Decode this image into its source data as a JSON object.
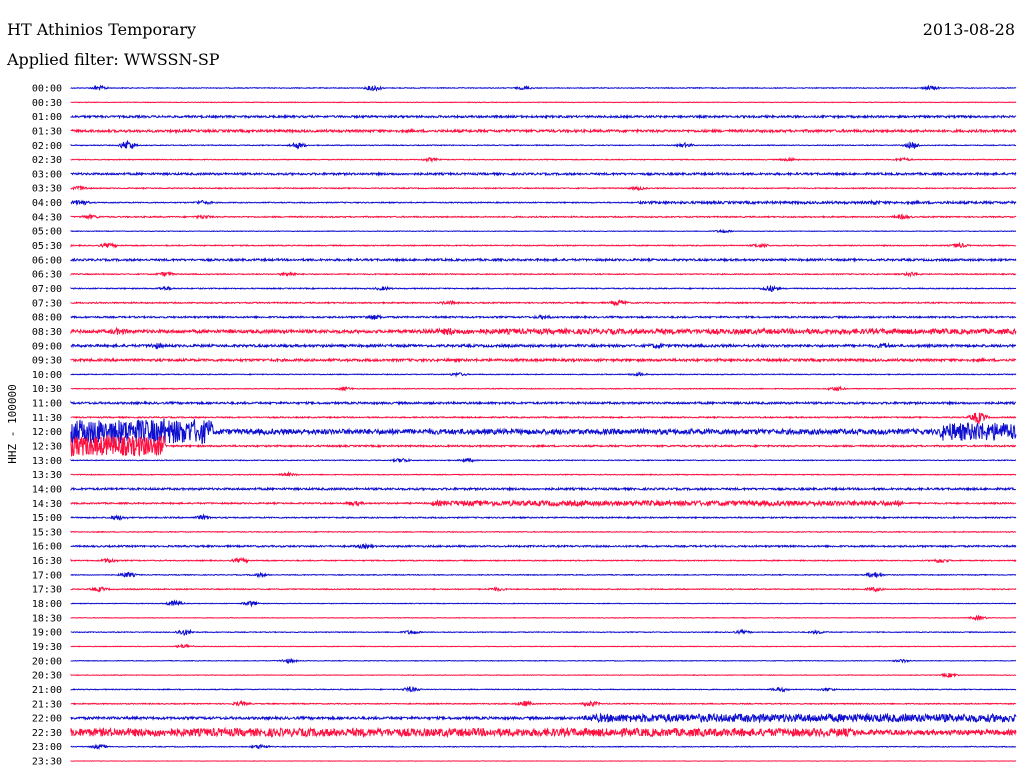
{
  "header": {
    "title": "HT Athinios Temporary",
    "date": "2013-08-28",
    "filter": "Applied filter: WWSSN-SP"
  },
  "chart_data": {
    "type": "line",
    "title": "HT Athinios Temporary",
    "ylabel": "HHZ - 100000",
    "colors": [
      "#1010d0",
      "#ff1040"
    ],
    "rows": [
      {
        "label": "00:00",
        "amp": 0.4,
        "events": [
          [
            0.03,
            2
          ],
          [
            0.32,
            3
          ],
          [
            0.48,
            1.5
          ],
          [
            0.91,
            2
          ]
        ]
      },
      {
        "label": "00:30",
        "amp": 0.3,
        "events": []
      },
      {
        "label": "01:00",
        "amp": 1.0,
        "events": []
      },
      {
        "label": "01:30",
        "amp": 1.2,
        "events": []
      },
      {
        "label": "02:00",
        "amp": 0.4,
        "events": [
          [
            0.06,
            5
          ],
          [
            0.24,
            3
          ],
          [
            0.65,
            2
          ],
          [
            0.89,
            3
          ]
        ]
      },
      {
        "label": "02:30",
        "amp": 0.4,
        "events": [
          [
            0.38,
            1.5
          ],
          [
            0.76,
            1.5
          ],
          [
            0.88,
            1.5
          ]
        ]
      },
      {
        "label": "03:00",
        "amp": 1.0,
        "events": []
      },
      {
        "label": "03:30",
        "amp": 0.5,
        "events": [
          [
            0.01,
            2
          ],
          [
            0.6,
            1.5
          ]
        ]
      },
      {
        "label": "04:00",
        "amp": 0.5,
        "events": [
          [
            0.01,
            3
          ],
          [
            0.14,
            2
          ],
          [
            0.85,
            2
          ]
        ]
      },
      {
        "label": "04:30",
        "amp": 0.6,
        "events": [
          [
            0.02,
            2
          ],
          [
            0.14,
            1.5
          ],
          [
            0.88,
            2
          ]
        ]
      },
      {
        "label": "05:00",
        "amp": 0.3,
        "events": [
          [
            0.69,
            1.5
          ]
        ]
      },
      {
        "label": "05:30",
        "amp": 0.5,
        "events": [
          [
            0.04,
            2
          ],
          [
            0.73,
            2
          ],
          [
            0.94,
            2
          ]
        ]
      },
      {
        "label": "06:00",
        "amp": 1.0,
        "events": []
      },
      {
        "label": "06:30",
        "amp": 0.5,
        "events": [
          [
            0.1,
            2
          ],
          [
            0.23,
            2
          ],
          [
            0.89,
            2
          ]
        ]
      },
      {
        "label": "07:00",
        "amp": 0.5,
        "events": [
          [
            0.74,
            3
          ],
          [
            0.1,
            1.5
          ],
          [
            0.33,
            1.5
          ]
        ]
      },
      {
        "label": "07:30",
        "amp": 0.6,
        "events": [
          [
            0.58,
            2.5
          ],
          [
            0.4,
            1.5
          ]
        ]
      },
      {
        "label": "08:00",
        "amp": 0.8,
        "events": [
          [
            0.32,
            2
          ],
          [
            0.5,
            1.5
          ]
        ]
      },
      {
        "label": "08:30",
        "amp": 1.6,
        "events": [
          [
            0.4,
            2.5
          ],
          [
            0.05,
            2
          ]
        ]
      },
      {
        "label": "09:00",
        "amp": 1.0,
        "events": [
          [
            0.09,
            2
          ],
          [
            0.62,
            2
          ],
          [
            0.86,
            2
          ]
        ]
      },
      {
        "label": "09:30",
        "amp": 1.2,
        "events": []
      },
      {
        "label": "10:00",
        "amp": 0.4,
        "events": [
          [
            0.41,
            1.5
          ],
          [
            0.6,
            1.5
          ]
        ]
      },
      {
        "label": "10:30",
        "amp": 0.4,
        "events": [
          [
            0.29,
            1.5
          ],
          [
            0.81,
            2
          ]
        ]
      },
      {
        "label": "11:00",
        "amp": 1.0,
        "events": []
      },
      {
        "label": "11:30",
        "amp": 0.6,
        "events": [
          [
            0.96,
            6
          ]
        ]
      },
      {
        "label": "12:00",
        "amp": 1.8,
        "events": [
          [
            0.1,
            14
          ],
          [
            0.96,
            10
          ]
        ]
      },
      {
        "label": "12:30",
        "amp": 0.8,
        "events": [
          [
            0.04,
            12
          ]
        ]
      },
      {
        "label": "13:00",
        "amp": 0.4,
        "events": [
          [
            0.35,
            2
          ],
          [
            0.42,
            1.5
          ]
        ]
      },
      {
        "label": "13:30",
        "amp": 0.4,
        "events": [
          [
            0.23,
            1.5
          ]
        ]
      },
      {
        "label": "14:00",
        "amp": 1.0,
        "events": []
      },
      {
        "label": "14:30",
        "amp": 0.7,
        "events": [
          [
            0.54,
            2.5
          ],
          [
            0.3,
            2
          ]
        ]
      },
      {
        "label": "15:00",
        "amp": 0.6,
        "events": [
          [
            0.05,
            2
          ],
          [
            0.14,
            2
          ]
        ]
      },
      {
        "label": "15:30",
        "amp": 0.4,
        "events": []
      },
      {
        "label": "16:00",
        "amp": 0.8,
        "events": [
          [
            0.31,
            1.5
          ]
        ]
      },
      {
        "label": "16:30",
        "amp": 0.5,
        "events": [
          [
            0.04,
            2
          ],
          [
            0.18,
            2
          ],
          [
            0.92,
            2
          ]
        ]
      },
      {
        "label": "17:00",
        "amp": 0.4,
        "events": [
          [
            0.06,
            2.5
          ],
          [
            0.85,
            3
          ],
          [
            0.2,
            1.5
          ]
        ]
      },
      {
        "label": "17:30",
        "amp": 0.5,
        "events": [
          [
            0.03,
            2
          ],
          [
            0.45,
            1.5
          ],
          [
            0.85,
            2
          ]
        ]
      },
      {
        "label": "18:00",
        "amp": 0.3,
        "events": [
          [
            0.11,
            3
          ],
          [
            0.19,
            2.5
          ]
        ]
      },
      {
        "label": "18:30",
        "amp": 0.3,
        "events": [
          [
            0.96,
            2
          ]
        ]
      },
      {
        "label": "19:00",
        "amp": 0.4,
        "events": [
          [
            0.12,
            3
          ],
          [
            0.36,
            2
          ],
          [
            0.71,
            1.5
          ],
          [
            0.79,
            1.5
          ]
        ]
      },
      {
        "label": "19:30",
        "amp": 0.3,
        "events": [
          [
            0.12,
            2
          ]
        ]
      },
      {
        "label": "20:00",
        "amp": 0.3,
        "events": [
          [
            0.23,
            2
          ],
          [
            0.88,
            1.5
          ]
        ]
      },
      {
        "label": "20:30",
        "amp": 0.3,
        "events": [
          [
            0.93,
            2
          ]
        ]
      },
      {
        "label": "21:00",
        "amp": 0.4,
        "events": [
          [
            0.36,
            2.5
          ],
          [
            0.75,
            2
          ],
          [
            0.8,
            1.5
          ]
        ]
      },
      {
        "label": "21:30",
        "amp": 0.5,
        "events": [
          [
            0.18,
            2
          ],
          [
            0.48,
            2.5
          ],
          [
            0.55,
            2.5
          ]
        ]
      },
      {
        "label": "22:00",
        "amp": 1.2,
        "events": [
          [
            0.55,
            2
          ]
        ]
      },
      {
        "label": "22:30",
        "amp": 2.5,
        "events": []
      },
      {
        "label": "23:00",
        "amp": 0.4,
        "events": [
          [
            0.03,
            2
          ],
          [
            0.2,
            2
          ]
        ]
      },
      {
        "label": "23:30",
        "amp": 0.2,
        "events": []
      }
    ],
    "bands": [
      {
        "row": 8,
        "from": 0.6,
        "to": 1.0,
        "amp": 1.2
      },
      {
        "row": 17,
        "from": 0.37,
        "to": 1.0,
        "amp": 2.5
      },
      {
        "row": 18,
        "from": 0.0,
        "to": 1.0,
        "amp": 1.2
      },
      {
        "row": 24,
        "from": 0.0,
        "to": 0.15,
        "amp": 12
      },
      {
        "row": 24,
        "from": 0.15,
        "to": 0.92,
        "amp": 2.6
      },
      {
        "row": 24,
        "from": 0.92,
        "to": 1.0,
        "amp": 9
      },
      {
        "row": 25,
        "from": 0.0,
        "to": 0.1,
        "amp": 10
      },
      {
        "row": 29,
        "from": 0.38,
        "to": 0.88,
        "amp": 2.5
      },
      {
        "row": 44,
        "from": 0.55,
        "to": 1.0,
        "amp": 4
      },
      {
        "row": 45,
        "from": 0.0,
        "to": 0.83,
        "amp": 4
      },
      {
        "row": 45,
        "from": 0.83,
        "to": 0.92,
        "amp": 2.5
      }
    ]
  }
}
